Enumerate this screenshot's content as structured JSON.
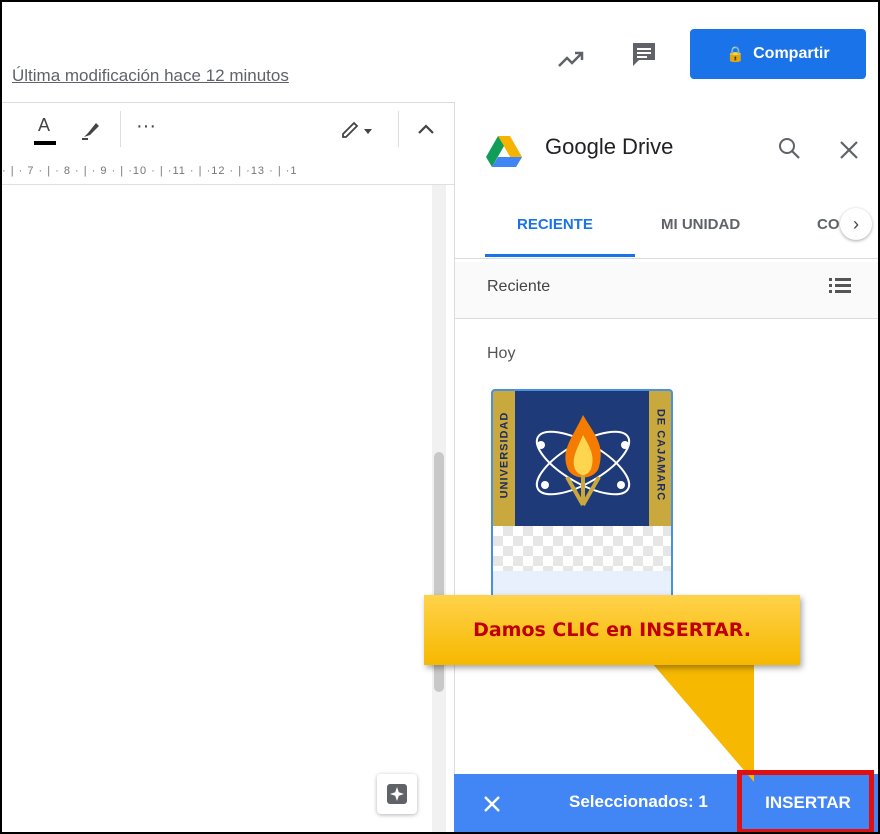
{
  "header": {
    "last_modified": "Última modificación hace 12 minutos",
    "share_label": "Compartir",
    "share_icon": "lock-icon",
    "trend_icon": "trending-icon",
    "comments_icon": "comment-icon"
  },
  "doc_toolbar": {
    "text_color_glyph": "A",
    "more_glyph": "···",
    "icons": [
      "text-color-icon",
      "highlighter-icon",
      "more-icon",
      "edit-mode-icon",
      "collapse-icon"
    ]
  },
  "ruler": {
    "text": "· | · 7 · | · 8 · | · 9 · | ·10 · | ·11 · | ·12 · | ·13 · | ·1"
  },
  "drive": {
    "title": "Google Drive",
    "tabs": [
      {
        "label": "RECIENTE",
        "active": true
      },
      {
        "label": "MI UNIDAD",
        "active": false
      },
      {
        "label": "CO",
        "active": false
      }
    ],
    "section_label": "Reciente",
    "group_label": "Hoy",
    "selected_file": {
      "left_text": "UNIVERSIDAD",
      "right_text": "DE CAJAMARC"
    },
    "footer": {
      "selected_text": "Seleccionados: 1",
      "insert_label": "INSERTAR"
    }
  },
  "annotation": {
    "callout_text": "Damos CLIC en INSERTAR."
  },
  "colors": {
    "accent_blue": "#1a73e8",
    "footer_blue": "#4285f4",
    "callout_yellow": "#f6b800",
    "callout_text": "#c00000",
    "highlight_red": "#e01010"
  }
}
